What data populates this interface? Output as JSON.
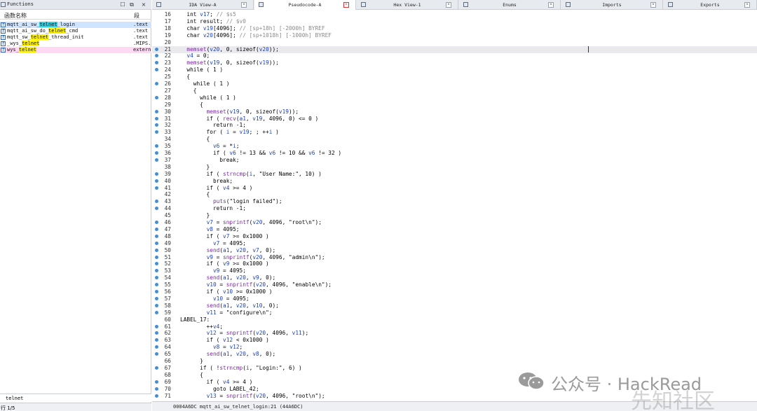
{
  "functions_panel": {
    "title": "Functions",
    "col_name": "函数名称",
    "col_segment": "段",
    "items": [
      {
        "pre": "mqtt_ai_sw_",
        "hl": "telnet",
        "post": "_login",
        "segment": ".text",
        "hl_color": "cyan",
        "selected": true
      },
      {
        "pre": "mqtt_ai_sw_do_",
        "hl": "telnet",
        "post": "_cmd",
        "segment": ".text",
        "hl_color": "yellow",
        "selected": false
      },
      {
        "pre": "mqtt_sw_",
        "hl": "telnet",
        "post": "_thread_init",
        "segment": ".text",
        "hl_color": "yellow",
        "selected": false
      },
      {
        "pre": "_wys_",
        "hl": "telnet",
        "post": "",
        "segment": ".MIPS.",
        "hl_color": "yellow",
        "selected": false
      },
      {
        "pre": "wys_",
        "hl": "telnet",
        "post": "",
        "segment": "extern",
        "hl_color": "yellow",
        "selected": false,
        "pink": true
      }
    ],
    "search_text": "telnet",
    "status": "行 1/5"
  },
  "tabs": [
    {
      "label": "IDA View-A",
      "active": false
    },
    {
      "label": "Pseudocode-A",
      "active": true
    },
    {
      "label": "Hex View-1",
      "active": false
    },
    {
      "label": "Enums",
      "active": false
    },
    {
      "label": "Imports",
      "active": false
    },
    {
      "label": "Exports",
      "active": false
    }
  ],
  "code_lines": [
    {
      "n": "16",
      "bp": false,
      "t": "  int v17; // $s5"
    },
    {
      "n": "17",
      "bp": false,
      "t": "  int result; // $v0"
    },
    {
      "n": "18",
      "bp": false,
      "t": "  char v19[4096]; // [sp+18h] [-2000h] BYREF"
    },
    {
      "n": "19",
      "bp": false,
      "t": "  char v20[4096]; // [sp+1018h] [-1000h] BYREF"
    },
    {
      "n": "20",
      "bp": false,
      "t": ""
    },
    {
      "n": "21",
      "bp": true,
      "t": "  memset(v20, 0, sizeof(v20));"
    },
    {
      "n": "22",
      "bp": true,
      "t": "  v4 = 0;"
    },
    {
      "n": "23",
      "bp": true,
      "t": "  memset(v19, 0, sizeof(v19));"
    },
    {
      "n": "24",
      "bp": true,
      "t": "  while ( 1 )"
    },
    {
      "n": "25",
      "bp": false,
      "t": "  {"
    },
    {
      "n": "26",
      "bp": true,
      "t": "    while ( 1 )"
    },
    {
      "n": "27",
      "bp": false,
      "t": "    {"
    },
    {
      "n": "28",
      "bp": true,
      "t": "      while ( 1 )"
    },
    {
      "n": "29",
      "bp": false,
      "t": "      {"
    },
    {
      "n": "30",
      "bp": true,
      "t": "        memset(v19, 0, sizeof(v19));"
    },
    {
      "n": "31",
      "bp": true,
      "t": "        if ( recv(a1, v19, 4096, 0) <= 0 )"
    },
    {
      "n": "32",
      "bp": true,
      "t": "          return -1;"
    },
    {
      "n": "33",
      "bp": true,
      "t": "        for ( i = v19; ; ++i )"
    },
    {
      "n": "34",
      "bp": false,
      "t": "        {"
    },
    {
      "n": "35",
      "bp": true,
      "t": "          v6 = *i;"
    },
    {
      "n": "36",
      "bp": true,
      "t": "          if ( v6 != 13 && v6 != 10 && v6 != 32 )"
    },
    {
      "n": "37",
      "bp": true,
      "t": "            break;"
    },
    {
      "n": "38",
      "bp": false,
      "t": "        }"
    },
    {
      "n": "39",
      "bp": true,
      "t": "        if ( strncmp(i, \"User Name:\", 10) )"
    },
    {
      "n": "40",
      "bp": true,
      "t": "          break;"
    },
    {
      "n": "41",
      "bp": true,
      "t": "        if ( v4 >= 4 )"
    },
    {
      "n": "42",
      "bp": false,
      "t": "        {"
    },
    {
      "n": "43",
      "bp": true,
      "t": "          puts(\"login failed\");"
    },
    {
      "n": "44",
      "bp": true,
      "t": "          return -1;"
    },
    {
      "n": "45",
      "bp": false,
      "t": "        }"
    },
    {
      "n": "46",
      "bp": true,
      "t": "        v7 = snprintf(v20, 4096, \"root\\n\");"
    },
    {
      "n": "47",
      "bp": true,
      "t": "        v8 = 4095;"
    },
    {
      "n": "48",
      "bp": true,
      "t": "        if ( v7 >= 0x1000 )"
    },
    {
      "n": "49",
      "bp": true,
      "t": "          v7 = 4095;"
    },
    {
      "n": "50",
      "bp": true,
      "t": "        send(a1, v20, v7, 0);"
    },
    {
      "n": "51",
      "bp": true,
      "t": "        v9 = snprintf(v20, 4096, \"admin\\n\");"
    },
    {
      "n": "52",
      "bp": true,
      "t": "        if ( v9 >= 0x1000 )"
    },
    {
      "n": "53",
      "bp": true,
      "t": "          v9 = 4095;"
    },
    {
      "n": "54",
      "bp": true,
      "t": "        send(a1, v20, v9, 0);"
    },
    {
      "n": "55",
      "bp": true,
      "t": "        v10 = snprintf(v20, 4096, \"enable\\n\");"
    },
    {
      "n": "56",
      "bp": true,
      "t": "        if ( v10 >= 0x1000 )"
    },
    {
      "n": "57",
      "bp": true,
      "t": "          v10 = 4095;"
    },
    {
      "n": "58",
      "bp": true,
      "t": "        send(a1, v20, v10, 0);"
    },
    {
      "n": "59",
      "bp": true,
      "t": "        v11 = \"configure\\n\";"
    },
    {
      "n": "60",
      "bp": false,
      "t": "LABEL_17:"
    },
    {
      "n": "61",
      "bp": true,
      "t": "        ++v4;"
    },
    {
      "n": "62",
      "bp": true,
      "t": "        v12 = snprintf(v20, 4096, v11);"
    },
    {
      "n": "63",
      "bp": true,
      "t": "        if ( v12 < 0x1000 )"
    },
    {
      "n": "64",
      "bp": true,
      "t": "          v8 = v12;"
    },
    {
      "n": "65",
      "bp": true,
      "t": "        send(a1, v20, v8, 0);"
    },
    {
      "n": "66",
      "bp": false,
      "t": "      }"
    },
    {
      "n": "67",
      "bp": true,
      "t": "      if ( !strncmp(i, \"Login:\", 6) )"
    },
    {
      "n": "68",
      "bp": false,
      "t": "      {"
    },
    {
      "n": "69",
      "bp": true,
      "t": "        if ( v4 >= 4 )"
    },
    {
      "n": "70",
      "bp": true,
      "t": "          goto LABEL_42;"
    },
    {
      "n": "71",
      "bp": true,
      "t": "        v13 = snprintf(v20, 4096, \"root\\n\");"
    }
  ],
  "status_bar": "0004A6DC mqtt_ai_sw_telnet_login:21 (44A6DC)",
  "watermark": {
    "text": "公众号 · HackRead",
    "faint": "先知社区"
  },
  "colors": {
    "keyword": "#1a3fbf",
    "comment": "#8a8a8a",
    "function": "#7b24a8",
    "breakpoint": "#3d8fe0",
    "highlight_yellow": "#fff200",
    "highlight_cyan": "#2fd3e6"
  }
}
